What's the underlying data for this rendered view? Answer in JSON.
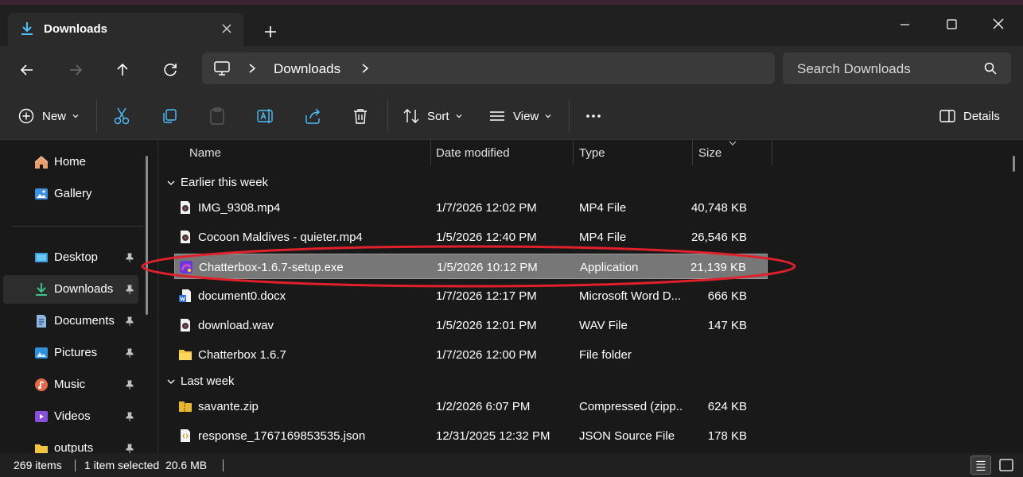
{
  "window": {
    "tab_title": "Downloads"
  },
  "address": {
    "crumb_label": "Downloads",
    "search_placeholder": "Search Downloads"
  },
  "toolbar": {
    "new_label": "New",
    "sort_label": "Sort",
    "view_label": "View",
    "details_label": "Details"
  },
  "sidebar": {
    "items": [
      {
        "label": "Home",
        "icon": "home-icon"
      },
      {
        "label": "Gallery",
        "icon": "gallery-icon"
      },
      {
        "label": "Desktop",
        "icon": "desktop-icon"
      },
      {
        "label": "Downloads",
        "icon": "download-icon"
      },
      {
        "label": "Documents",
        "icon": "documents-icon"
      },
      {
        "label": "Pictures",
        "icon": "pictures-icon"
      },
      {
        "label": "Music",
        "icon": "music-icon"
      },
      {
        "label": "Videos",
        "icon": "videos-icon"
      },
      {
        "label": "outputs",
        "icon": "folder-icon"
      }
    ]
  },
  "columns": {
    "name": "Name",
    "date": "Date modified",
    "type": "Type",
    "size": "Size"
  },
  "groups": {
    "earlier": "Earlier this week",
    "last": "Last week"
  },
  "files": [
    {
      "name": "IMG_9308.mp4",
      "date": "1/7/2026 12:02 PM",
      "type": "MP4 File",
      "size": "40,748 KB",
      "icon": "video-file-icon"
    },
    {
      "name": "Cocoon Maldives - quieter.mp4",
      "date": "1/5/2026 12:40 PM",
      "type": "MP4 File",
      "size": "26,546 KB",
      "icon": "video-file-icon"
    },
    {
      "name": "Chatterbox-1.6.7-setup.exe",
      "date": "1/5/2026 10:12 PM",
      "type": "Application",
      "size": "21,139 KB",
      "icon": "app-icon"
    },
    {
      "name": "document0.docx",
      "date": "1/7/2026 12:17 PM",
      "type": "Microsoft Word D...",
      "size": "666 KB",
      "icon": "word-doc-icon"
    },
    {
      "name": "download.wav",
      "date": "1/5/2026 12:01 PM",
      "type": "WAV File",
      "size": "147 KB",
      "icon": "audio-file-icon"
    },
    {
      "name": "Chatterbox 1.6.7",
      "date": "1/7/2026 12:00 PM",
      "type": "File folder",
      "size": "",
      "icon": "folder-icon"
    },
    {
      "name": "savante.zip",
      "date": "1/2/2026 6:07 PM",
      "type": "Compressed (zipp...",
      "size": "624 KB",
      "icon": "zip-folder-icon"
    },
    {
      "name": "response_1767169853535.json",
      "date": "12/31/2025 12:32 PM",
      "type": "JSON Source File",
      "size": "178 KB",
      "icon": "json-file-icon"
    }
  ],
  "status": {
    "items": "269 items",
    "selected": "1 item selected  20.6 MB"
  },
  "colors": {
    "accent": "#4cc2ff",
    "highlight_circle": "#e0202a",
    "selected_row": "#777777"
  }
}
